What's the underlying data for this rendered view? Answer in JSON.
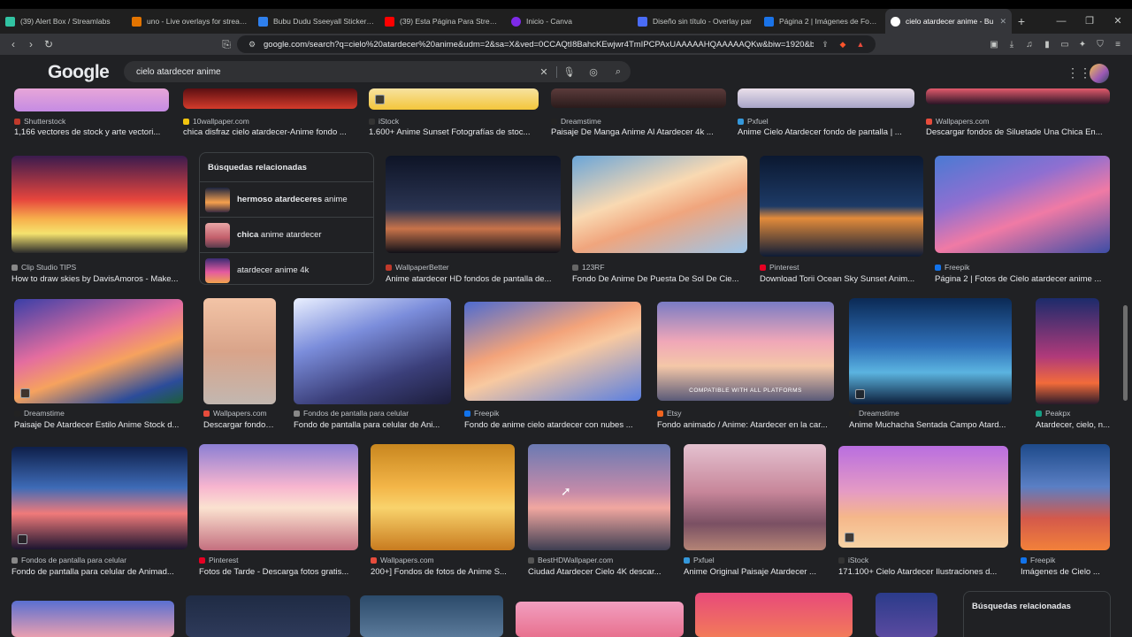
{
  "tabs": [
    {
      "label": "(39) Alert Box / Streamlabs",
      "color": "#31c3a2"
    },
    {
      "label": "uno - Live overlays for streamin",
      "color": "#e37400"
    },
    {
      "label": "Bubu Dudu Sseeyall Sticker - B",
      "color": "#2f80ed"
    },
    {
      "label": "(39) Esta Página Para Streamer",
      "color": "#ff0000"
    },
    {
      "label": "Inicio - Canva",
      "color": "#7d2ae8"
    },
    {
      "label": "Diseño sin título - Overlay par",
      "color": "#4a6cf7"
    },
    {
      "label": "Página 2 | Imágenes de Fondo",
      "color": "#1a73e8"
    },
    {
      "label": "cielo atardecer anime - Bu",
      "color": "#ffffff",
      "active": true
    }
  ],
  "address": {
    "url": "google.com/search?q=cielo%20atardecer%20anime&udm=2&sa=X&ved=0CCAQtI8BahcKEwjwr4TmIPCPAxUAAAAAHQAAAAAQKw&biw=1920&bih..."
  },
  "header": {
    "logo": "Google",
    "query": "cielo atardecer anime"
  },
  "related": {
    "title": "Búsquedas relacionadas",
    "items": [
      {
        "bold": "hermoso atardeceres",
        "rest": " anime"
      },
      {
        "bold": "chica",
        "rest": " anime atardecer"
      },
      {
        "bold": "",
        "rest": "atardecer anime 4k"
      }
    ]
  },
  "related2": {
    "title": "Búsquedas relacionadas"
  },
  "results": [
    {
      "source": "Shutterstock",
      "title": "1,166 vectores de stock y arte vectori...",
      "icon_color": "#c0392b"
    },
    {
      "source": "10wallpaper.com",
      "title": "chica disfraz cielo atardecer-Anime fondo ...",
      "icon_color": "#f1c40f"
    },
    {
      "source": "iStock",
      "title": "1.600+ Anime Sunset Fotografías de stoc...",
      "icon_color": "#333333"
    },
    {
      "source": "Dreamstime",
      "title": "Paisaje De Manga Anime Al Atardecer 4k ...",
      "icon_color": "#222222"
    },
    {
      "source": "Pxfuel",
      "title": "Anime Cielo Atardecer fondo de pantalla | ...",
      "icon_color": "#3498db"
    },
    {
      "source": "Wallpapers.com",
      "title": "Descargar fondos de Siluetade Una Chica En...",
      "icon_color": "#e74c3c"
    },
    {
      "source": "Clip Studio TIPS",
      "title": "How to draw skies by DavisAmoros - Make...",
      "icon_color": "#888888"
    },
    {
      "source": "WallpaperBetter",
      "title": "Anime atardecer HD fondos de pantalla de...",
      "icon_color": "#c0392b"
    },
    {
      "source": "123RF",
      "title": "Fondo De Anime De Puesta De Sol De Cie...",
      "icon_color": "#666666"
    },
    {
      "source": "Pinterest",
      "title": "Download Torii Ocean Sky Sunset Anim...",
      "icon_color": "#e60023"
    },
    {
      "source": "Freepik",
      "title": "Página 2 | Fotos de Cielo atardecer anime ...",
      "icon_color": "#1273eb"
    },
    {
      "source": "Dreamstime",
      "title": "Paisaje De Atardecer Estilo Anime Stock d...",
      "icon_color": "#222222"
    },
    {
      "source": "Wallpapers.com",
      "title": "Descargar fondos ...",
      "icon_color": "#e74c3c"
    },
    {
      "source": "Fondos de pantalla para celular",
      "title": "Fondo de pantalla para celular de Ani...",
      "icon_color": "#888888"
    },
    {
      "source": "Freepik",
      "title": "Fondo de anime cielo atardecer con nubes ...",
      "icon_color": "#1273eb"
    },
    {
      "source": "Etsy",
      "title": "Fondo animado / Anime: Atardecer en la car...",
      "icon_color": "#f1641e"
    },
    {
      "source": "Dreamstime",
      "title": "Anime Muchacha Sentada Campo Atard...",
      "icon_color": "#222222"
    },
    {
      "source": "Peakpx",
      "title": "Atardecer, cielo, n...",
      "icon_color": "#16a085"
    },
    {
      "source": "Fondos de pantalla para celular",
      "title": "Fondo de pantalla para celular de Animad...",
      "icon_color": "#888888"
    },
    {
      "source": "Pinterest",
      "title": "Fotos de Tarde - Descarga fotos gratis...",
      "icon_color": "#e60023"
    },
    {
      "source": "Wallpapers.com",
      "title": "200+] Fondos de fotos de Anime S...",
      "icon_color": "#e74c3c"
    },
    {
      "source": "BestHDWallpaper.com",
      "title": "Ciudad Atardecer Cielo 4K descar...",
      "icon_color": "#555555"
    },
    {
      "source": "Pxfuel",
      "title": "Anime Original Paisaje Atardecer ...",
      "icon_color": "#3498db"
    },
    {
      "source": "iStock",
      "title": "171.100+ Cielo Atardecer Ilustraciones d...",
      "icon_color": "#333333"
    },
    {
      "source": "Freepik",
      "title": "Imágenes de Cielo ...",
      "icon_color": "#1273eb"
    }
  ],
  "image_overlay_text": "COMPATIBLE WITH ALL PLATFORMS"
}
